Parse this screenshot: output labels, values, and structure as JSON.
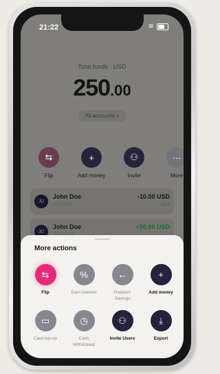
{
  "status": {
    "time": "21:22"
  },
  "balance": {
    "label": "Total funds · USD",
    "whole": "250",
    "decimal": ".00",
    "accounts_link": "All accounts >"
  },
  "quick_actions": [
    {
      "label": "Flip",
      "icon": "flip-arrows-icon",
      "glyph": "⇆"
    },
    {
      "label": "Add money",
      "icon": "plus-icon",
      "glyph": "+"
    },
    {
      "label": "Invite",
      "icon": "add-user-icon",
      "glyph": "⚇"
    },
    {
      "label": "More",
      "icon": "more-dots-icon",
      "glyph": "···"
    }
  ],
  "transactions": [
    {
      "initials": "JD",
      "name": "John Doe",
      "sub": "-10 USDM",
      "amount": "-10.00 USD",
      "date": "Jan 8",
      "color": "#161616"
    },
    {
      "initials": "JD",
      "name": "John Doe",
      "sub": "+50 USDM",
      "amount": "+50.00 USD",
      "date": "",
      "color": "#1b6b35"
    }
  ],
  "sheet": {
    "title": "More actions",
    "actions": [
      {
        "label": "Flip",
        "icon": "flip-arrows-icon",
        "glyph": "⇆",
        "style": "pink",
        "enabled": true
      },
      {
        "label": "Earn Interest",
        "icon": "percent-icon",
        "glyph": "%",
        "style": "gray",
        "enabled": false
      },
      {
        "label": "Redeem Savings",
        "icon": "arrow-left-icon",
        "glyph": "←",
        "style": "gray",
        "enabled": false
      },
      {
        "label": "Add money",
        "icon": "plus-icon",
        "glyph": "+",
        "style": "navy",
        "enabled": true
      },
      {
        "label": "Card top-up",
        "icon": "card-icon",
        "glyph": "▭",
        "style": "gray",
        "enabled": false
      },
      {
        "label": "Cash Withdrawal",
        "icon": "clock-icon",
        "glyph": "◷",
        "style": "gray",
        "enabled": false
      },
      {
        "label": "Invite Users",
        "icon": "add-user-icon",
        "glyph": "⚇",
        "style": "navy",
        "enabled": true
      },
      {
        "label": "Export",
        "icon": "download-icon",
        "glyph": "⤓",
        "style": "navy",
        "enabled": true
      }
    ]
  },
  "colors": {
    "accent": "#e52b78",
    "navy": "#24223d",
    "disabled": "#88878f",
    "positive": "#1b6b35"
  }
}
